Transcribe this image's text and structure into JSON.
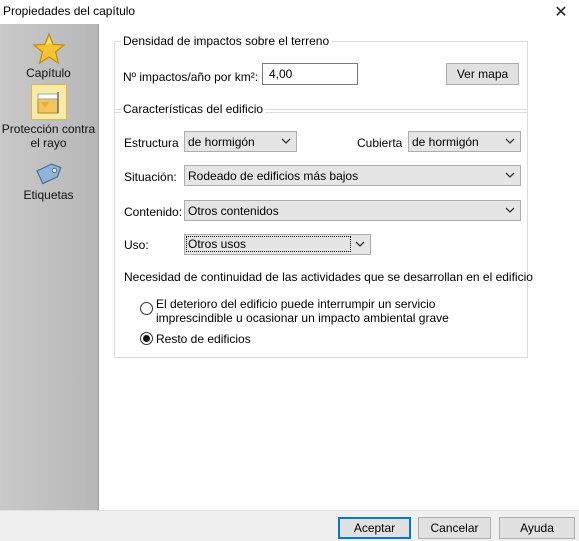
{
  "window": {
    "title": "Propiedades del capítulo"
  },
  "sidebar": {
    "items": [
      {
        "label": "Capítulo",
        "icon": "star-icon"
      },
      {
        "label": "Protección contra el rayo",
        "icon": "lightning-protection-icon"
      },
      {
        "label": "Etiquetas",
        "icon": "tag-icon"
      }
    ]
  },
  "density": {
    "legend": "Densidad de impactos sobre el terreno",
    "impacts_label": "Nº impactos/año por km²:",
    "impacts_value": "4,00",
    "map_button": "Ver mapa"
  },
  "building": {
    "legend": "Características del edificio",
    "structure_label": "Estructura",
    "structure_value": "de hormigón",
    "roof_label": "Cubierta",
    "roof_value": "de hormigón",
    "situation_label": "Situación:",
    "situation_value": "Rodeado de edificios más bajos",
    "content_label": "Contenido:",
    "content_value": "Otros contenidos",
    "use_label": "Uso:",
    "use_value": "Otros usos",
    "continuity_text": "Necesidad de continuidad de las actividades que se desarrollan en el edificio",
    "option1_label": "El deterioro del edificio puede interrumpir un servicio imprescindible u ocasionar un impacto ambiental grave",
    "option2_label": "Resto de edificios",
    "selected_option": 2
  },
  "footer": {
    "accept": "Aceptar",
    "cancel": "Cancelar",
    "help": "Ayuda"
  }
}
